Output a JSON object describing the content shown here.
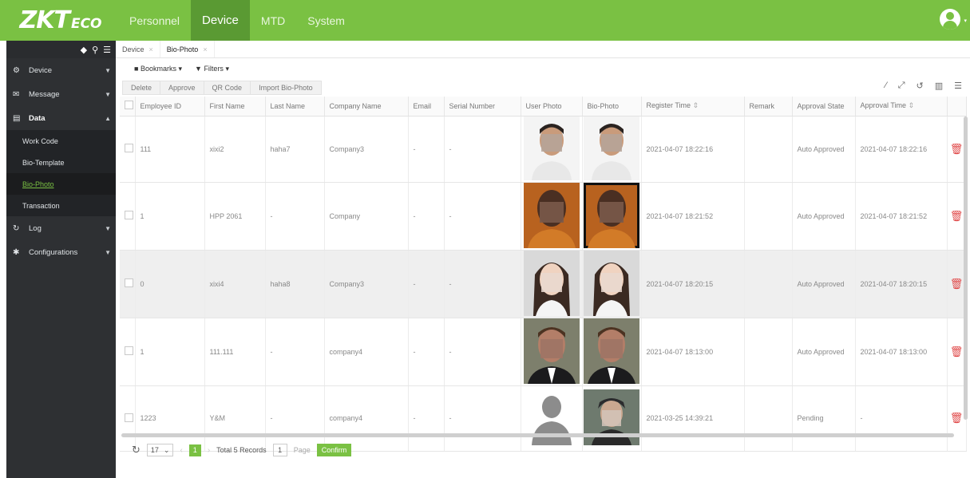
{
  "brand": {
    "logo_main": "ZKT",
    "logo_small": "ECO"
  },
  "topnav": [
    "Personnel",
    "Device",
    "MTD",
    "System"
  ],
  "sidebar": {
    "groups": [
      {
        "label": "Device",
        "icon": "device-icon"
      },
      {
        "label": "Message",
        "icon": "message-icon"
      },
      {
        "label": "Data",
        "icon": "data-icon"
      },
      {
        "label": "Log",
        "icon": "log-icon"
      },
      {
        "label": "Configurations",
        "icon": "configurations-icon"
      }
    ],
    "data_items": [
      "Work Code",
      "Bio-Template",
      "Bio-Photo",
      "Transaction"
    ]
  },
  "tabs": [
    "Device",
    "Bio-Photo"
  ],
  "toolbar": {
    "bookmarks": "Bookmarks",
    "filters": "Filters"
  },
  "actions": [
    "Delete",
    "Approve",
    "QR Code",
    "Import Bio-Photo"
  ],
  "table": {
    "columns": [
      "Employee ID",
      "First Name",
      "Last Name",
      "Company Name",
      "Email",
      "Serial Number",
      "User Photo",
      "Bio-Photo",
      "Register Time",
      "Remark",
      "Approval State",
      "Approval Time"
    ],
    "rows": [
      {
        "id": "111",
        "first": "xixi2",
        "last": "haha7",
        "company": "Company3",
        "email": "-",
        "serial": "-",
        "register": "2021-04-07 18:22:16",
        "remark": "",
        "state": "Auto Approved",
        "approval_time": "2021-04-07 18:22:16"
      },
      {
        "id": "1",
        "first": "HPP 2061",
        "last": "-",
        "company": "Company",
        "email": "-",
        "serial": "-",
        "register": "2021-04-07 18:21:52",
        "remark": "",
        "state": "Auto Approved",
        "approval_time": "2021-04-07 18:21:52"
      },
      {
        "id": "0",
        "first": "xixi4",
        "last": "haha8",
        "company": "Company3",
        "email": "-",
        "serial": "-",
        "register": "2021-04-07 18:20:15",
        "remark": "",
        "state": "Auto Approved",
        "approval_time": "2021-04-07 18:20:15"
      },
      {
        "id": "1",
        "first": "111.111",
        "last": "-",
        "company": "company4",
        "email": "-",
        "serial": "-",
        "register": "2021-04-07 18:13:00",
        "remark": "",
        "state": "Auto Approved",
        "approval_time": "2021-04-07 18:13:00"
      },
      {
        "id": "1223",
        "first": "Y&M",
        "last": "-",
        "company": "company4",
        "email": "-",
        "serial": "-",
        "register": "2021-03-25 14:39:21",
        "remark": "",
        "state": "Pending",
        "approval_time": "-"
      }
    ]
  },
  "pager": {
    "page_size": "17",
    "current": "1",
    "total": "Total 5 Records",
    "page_input": "1",
    "page_label": "Page",
    "confirm": "Confirm"
  }
}
